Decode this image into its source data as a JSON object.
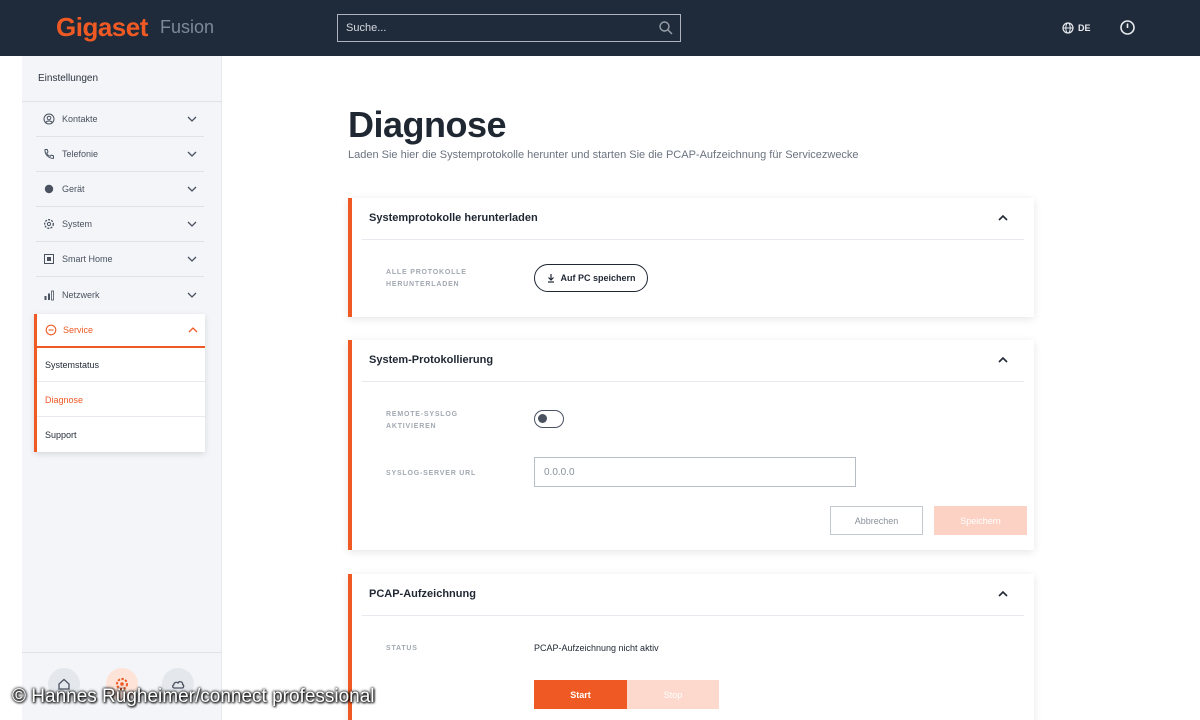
{
  "header": {
    "logo": "Gigaset",
    "product": "Fusion",
    "search_placeholder": "Suche...",
    "language": "DE"
  },
  "sidebar": {
    "title": "Einstellungen",
    "items": [
      {
        "label": "Kontakte",
        "icon": "contacts-icon"
      },
      {
        "label": "Telefonie",
        "icon": "phone-icon"
      },
      {
        "label": "Gerät",
        "icon": "device-icon"
      },
      {
        "label": "System",
        "icon": "gear-icon"
      },
      {
        "label": "Smart Home",
        "icon": "smart-home-icon"
      },
      {
        "label": "Netzwerk",
        "icon": "network-icon"
      }
    ],
    "service": {
      "label": "Service",
      "icon": "service-icon",
      "subitems": [
        {
          "label": "Systemstatus",
          "active": false
        },
        {
          "label": "Diagnose",
          "active": true
        },
        {
          "label": "Support",
          "active": false
        }
      ]
    }
  },
  "page": {
    "title": "Diagnose",
    "subtitle": "Laden Sie hier die Systemprotokolle herunter und starten Sie die PCAP-Aufzeichnung für Servicezwecke"
  },
  "cards": {
    "logs": {
      "title": "Systemprotokolle herunterladen",
      "field_label": "Alle Protokolle herunterladen",
      "button": "Auf PC speichern"
    },
    "syslog": {
      "title": "System-Protokollierung",
      "toggle_label": "Remote-Syslog aktivieren",
      "toggle_on": false,
      "url_label": "Syslog-Server URL",
      "url_placeholder": "0.0.0.0",
      "cancel": "Abbrechen",
      "save": "Speichern"
    },
    "pcap": {
      "title": "PCAP-Aufzeichnung",
      "status_label": "Status",
      "status_value": "PCAP-Aufzeichnung nicht aktiv",
      "start": "Start",
      "stop": "Stop"
    }
  },
  "credit": "© Hannes Rügheimer/connect professional",
  "colors": {
    "accent": "#ef5a24",
    "header_bg": "#1f2a3a",
    "sidebar_bg": "#f3f5f8"
  }
}
